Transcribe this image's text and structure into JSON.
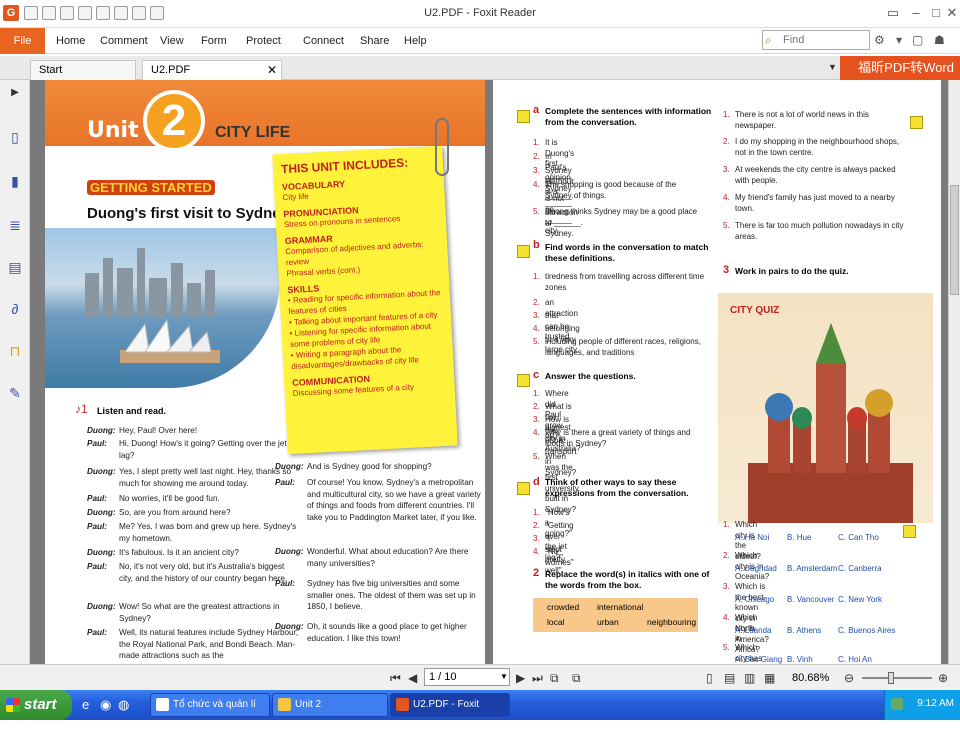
{
  "window": {
    "title": "U2.PDF - Foxit Reader"
  },
  "menu": {
    "file": "File",
    "items": [
      "Home",
      "Comment",
      "View",
      "Form",
      "Protect",
      "Connect",
      "Share",
      "Help"
    ],
    "find_placeholder": "Find"
  },
  "tabs": [
    {
      "label": "Start"
    },
    {
      "label": "U2.PDF"
    }
  ],
  "promo": "福昕PDF转Word",
  "page_left": {
    "unit_word": "Unit",
    "unit_number": "2",
    "unit_title": "CITY LIFE",
    "section": "GETTING STARTED",
    "lesson_title": "Duong's first visit to Sydney",
    "listen_label": "Listen and read.",
    "dialogue_left": [
      {
        "speaker": "Duong:",
        "text": "Hey, Paul! Over here!"
      },
      {
        "speaker": "Paul:",
        "text": "Hi, Duong! How's it going? Getting over the jet lag?"
      },
      {
        "speaker": "Duong:",
        "text": "Yes, I slept pretty well last night. Hey, thanks so much for showing me around today."
      },
      {
        "speaker": "Paul:",
        "text": "No worries, it'll be good fun."
      },
      {
        "speaker": "Duong:",
        "text": "So, are you from around here?"
      },
      {
        "speaker": "Paul:",
        "text": "Me? Yes, I was born and grew up here. Sydney's my hometown."
      },
      {
        "speaker": "Duong:",
        "text": "It's fabulous. Is it an ancient city?"
      },
      {
        "speaker": "Paul:",
        "text": "No, it's not very old, but it's Australia's biggest city, and the history of our country began here."
      },
      {
        "speaker": "Duong:",
        "text": "Wow! So what are the greatest attractions in Sydney?"
      },
      {
        "speaker": "Paul:",
        "text": "Well, its natural features include Sydney Harbour, the Royal National Park, and Bondi Beach. Man-made attractions such as the"
      }
    ],
    "dialogue_right": [
      {
        "speaker": "Duong:",
        "text": "And is Sydney good for shopping?"
      },
      {
        "speaker": "Paul:",
        "text": "Of course! You know, Sydney's a metropolitan and multicultural city, so we have a great variety of things and foods from different countries. I'll take you to Paddington Market later, if you like."
      },
      {
        "speaker": "Duong:",
        "text": "Wonderful. What about education? Are there many universities?"
      },
      {
        "speaker": "Paul:",
        "text": "Sydney has five big universities and some smaller ones. The oldest of them was set up in 1850, I believe."
      },
      {
        "speaker": "Duong:",
        "text": "Oh, it sounds like a good place to get higher education. I like this town!"
      }
    ],
    "note": {
      "heading": "THIS UNIT INCLUDES:",
      "sections": [
        {
          "title": "VOCABULARY",
          "lines": [
            "City life"
          ]
        },
        {
          "title": "PRONUNCIATION",
          "lines": [
            "Stress on pronouns in sentences"
          ]
        },
        {
          "title": "GRAMMAR",
          "lines": [
            "Comparison of adjectives and adverbs: review",
            "Phrasal verbs (cont.)"
          ]
        },
        {
          "title": "SKILLS",
          "lines": [
            "• Reading for specific information about the features of cities",
            "• Talking about important features of a city",
            "• Listening for specific information about some problems of city life",
            "• Writing a paragraph about the disadvantages/drawbacks of city life"
          ]
        },
        {
          "title": "COMMUNICATION",
          "lines": [
            "Discussing some features of a city"
          ]
        }
      ]
    }
  },
  "page_right": {
    "ex_a": {
      "letter": "a",
      "head": "Complete the sentences with information from the conversation.",
      "items": [
        "It is Duong's first ______ to Sydney.",
        "In Paul's opinion, Sydney is not an ______ city.",
        "Sydney Harbour is a ______ attraction of Sydney.",
        "The shopping is good because of the ______ of things.",
        "Duong thinks Sydney may be a good place to ______."
      ]
    },
    "ex_b": {
      "letter": "b",
      "head": "Find words in the conversation to match these definitions.",
      "items": [
        "tiredness from travelling across different time zones",
        "an attraction",
        "that can be trusted",
        "belonging to a very large city",
        "including people of different races, religions, languages, and traditions"
      ]
    },
    "ex_c": {
      "letter": "c",
      "head": "Answer the questions.",
      "items": [
        "Where did Paul grow up?",
        "What is the biggest city in Australia?",
        "How is the public transport in Sydney?",
        "Why is there a great variety of things and foods in Sydney?",
        "When was the first university built in Sydney?"
      ]
    },
    "ex_d": {
      "letter": "d",
      "head": "Think of other ways to say these expressions from the conversation.",
      "items": [
        "\"How's it going?\"",
        "\"Getting over the jet lag?\"",
        "\"I slept pretty well\"",
        "\"No worries\""
      ]
    },
    "ex_2": {
      "number": "2",
      "head": "Replace the word(s) in italics with one of the words from the box.",
      "words": [
        "crowded",
        "international",
        "local",
        "urban",
        "neighbouring"
      ]
    },
    "ex_2_sentences": [
      "There is not a lot of world news in this newspaper.",
      "I do my shopping in the neighbourhood shops, not in the town centre.",
      "At weekends the city centre is always packed with people.",
      "My friend's family has just moved to a nearby town.",
      "There is far too much pollution nowadays in city areas."
    ],
    "ex_3": {
      "number": "3",
      "head": "Work in pairs to do the quiz."
    },
    "quiz": {
      "heading": "CITY QUIZ",
      "questions": [
        {
          "q": "Which city is the oldest?",
          "options": [
            "A. Ha Noi",
            "B. Hue",
            "C. Can Tho"
          ]
        },
        {
          "q": "Which city is in Oceania?",
          "options": [
            "A. Baghdad",
            "B. Amsterdam",
            "C. Canberra"
          ]
        },
        {
          "q": "Which is the best-known city in North America?",
          "options": [
            "A. Chicago",
            "B. Vancouver",
            "C. New York"
          ]
        },
        {
          "q": "Which city is in Africa?",
          "options": [
            "A. Luanda",
            "B. Athens",
            "C. Buenos Aires"
          ]
        },
        {
          "q": "Which city has World Heritage status?",
          "options": [
            "A. Bac Giang",
            "B. Vinh",
            "C. Hoi An"
          ]
        }
      ]
    }
  },
  "status": {
    "page": "1 / 10",
    "zoom": "80.68%"
  },
  "taskbar": {
    "start": "start",
    "tasks": [
      "Tổ chức và quản lí họ...",
      "Unit 2",
      "U2.PDF - Foxit Reader"
    ],
    "clock": "9:12 AM"
  }
}
